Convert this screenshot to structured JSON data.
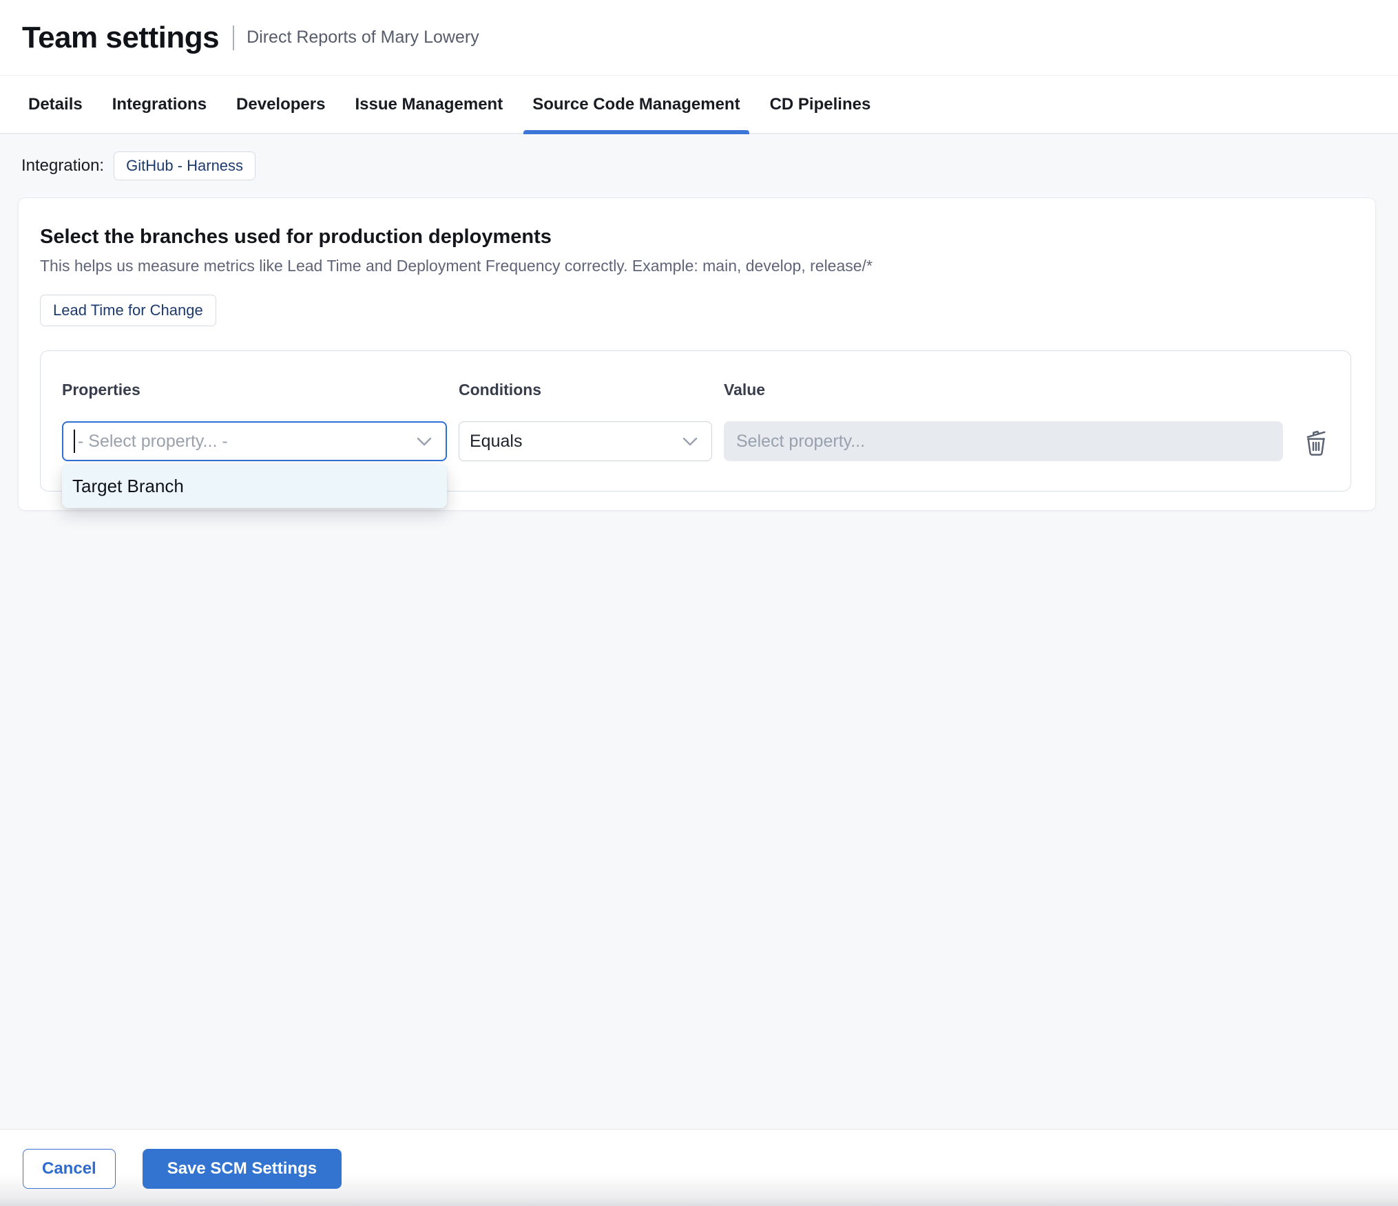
{
  "header": {
    "title": "Team settings",
    "subtitle": "Direct Reports of Mary Lowery"
  },
  "tabs": [
    {
      "label": "Details",
      "active": false
    },
    {
      "label": "Integrations",
      "active": false
    },
    {
      "label": "Developers",
      "active": false
    },
    {
      "label": "Issue Management",
      "active": false
    },
    {
      "label": "Source Code Management",
      "active": true
    },
    {
      "label": "CD Pipelines",
      "active": false
    }
  ],
  "integration": {
    "label": "Integration:",
    "value": "GitHub - Harness"
  },
  "card": {
    "heading": "Select the branches used for production deployments",
    "description": "This helps us measure metrics like Lead Time and Deployment Frequency correctly. Example: main, develop, release/*",
    "metric_chip": "Lead Time for Change",
    "rule": {
      "properties_label": "Properties",
      "conditions_label": "Conditions",
      "value_label": "Value",
      "property_placeholder": "- Select property... -",
      "condition_value": "Equals",
      "value_placeholder": "Select property...",
      "dropdown_options": [
        {
          "label": "Target Branch"
        }
      ]
    }
  },
  "footer": {
    "cancel_label": "Cancel",
    "save_label": "Save SCM Settings"
  },
  "icons": {
    "delete": "trash-icon",
    "select_arrow": "chevron-down-icon"
  },
  "colors": {
    "accent_blue": "#3474d1",
    "active_tab_underline": "#3c76d6",
    "focused_field_border": "#2e6fd6",
    "chip_text": "#1d3a6e",
    "dropdown_highlight": "#edf6fa",
    "disabled_field_bg": "#e7eaee",
    "page_bg": "#f7f8fa"
  }
}
